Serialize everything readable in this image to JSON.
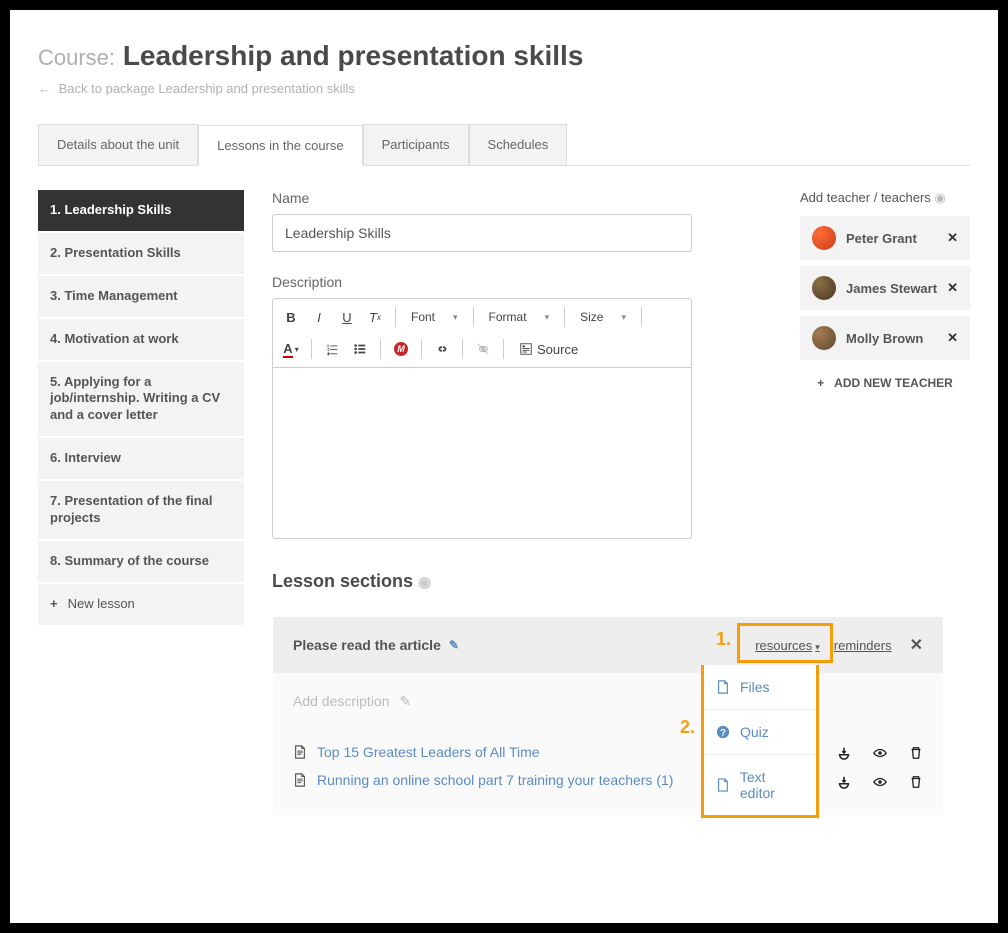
{
  "header": {
    "prefix": "Course:",
    "title": "Leadership and presentation skills",
    "backlink": "Back to package Leadership and presentation skills"
  },
  "tabs": [
    "Details about the unit",
    "Lessons in the course",
    "Participants",
    "Schedules"
  ],
  "active_tab": 1,
  "lessons": [
    "1. Leadership Skills",
    "2. Presentation Skills",
    "3. Time Management",
    "4. Motivation at work",
    "5. Applying for a job/internship. Writing a CV and a cover letter",
    "6. Interview",
    "7. Presentation of the final projects",
    "8. Summary of the course"
  ],
  "active_lesson": 0,
  "new_lesson_label": "New lesson",
  "form": {
    "name_label": "Name",
    "name_value": "Leadership Skills",
    "desc_label": "Description",
    "toolbar": {
      "font": "Font",
      "format": "Format",
      "size": "Size",
      "source": "Source"
    }
  },
  "teachers": {
    "title": "Add teacher / teachers",
    "list": [
      "Peter Grant",
      "James Stewart",
      "Molly Brown"
    ],
    "add_label": "ADD NEW TEACHER"
  },
  "sections": {
    "title": "Lesson sections",
    "section_title": "Please read the article",
    "resources_label": "resources",
    "reminders_label": "reminders",
    "add_description": "Add description",
    "items": [
      "Top 15 Greatest Leaders of All Time",
      "Running an online school part 7 training your teachers (1)"
    ],
    "dropdown": [
      "Files",
      "Quiz",
      "Text editor"
    ],
    "markers": {
      "one": "1.",
      "two": "2."
    }
  }
}
